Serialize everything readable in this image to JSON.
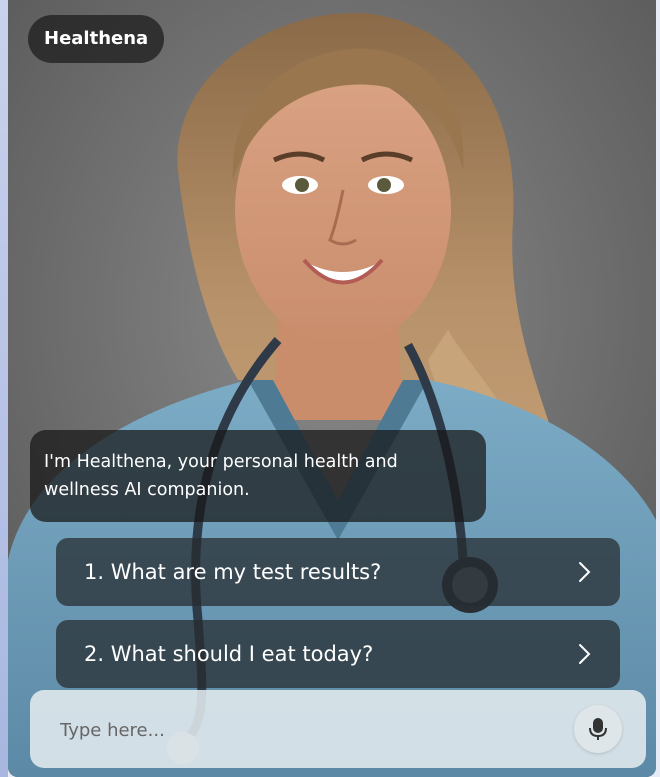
{
  "app": {
    "name": "Healthena"
  },
  "chat": {
    "greeting": "I'm Healthena, your personal health and wellness AI companion."
  },
  "suggestions": [
    {
      "label": "1. What are my test results?",
      "icon": "chevron-right-icon"
    },
    {
      "label": "2. What should I eat today?",
      "icon": "chevron-right-icon"
    }
  ],
  "input": {
    "placeholder": "Type here...",
    "value": "",
    "mic_icon": "microphone-icon"
  },
  "avatar": {
    "description_icon": "nurse-avatar-illustration"
  },
  "colors": {
    "background": "#6d6d6d",
    "scrubs": "#6f9db8",
    "bubble": "#161616",
    "suggestion": "#262c30",
    "input_bar": "#e2eaee"
  }
}
